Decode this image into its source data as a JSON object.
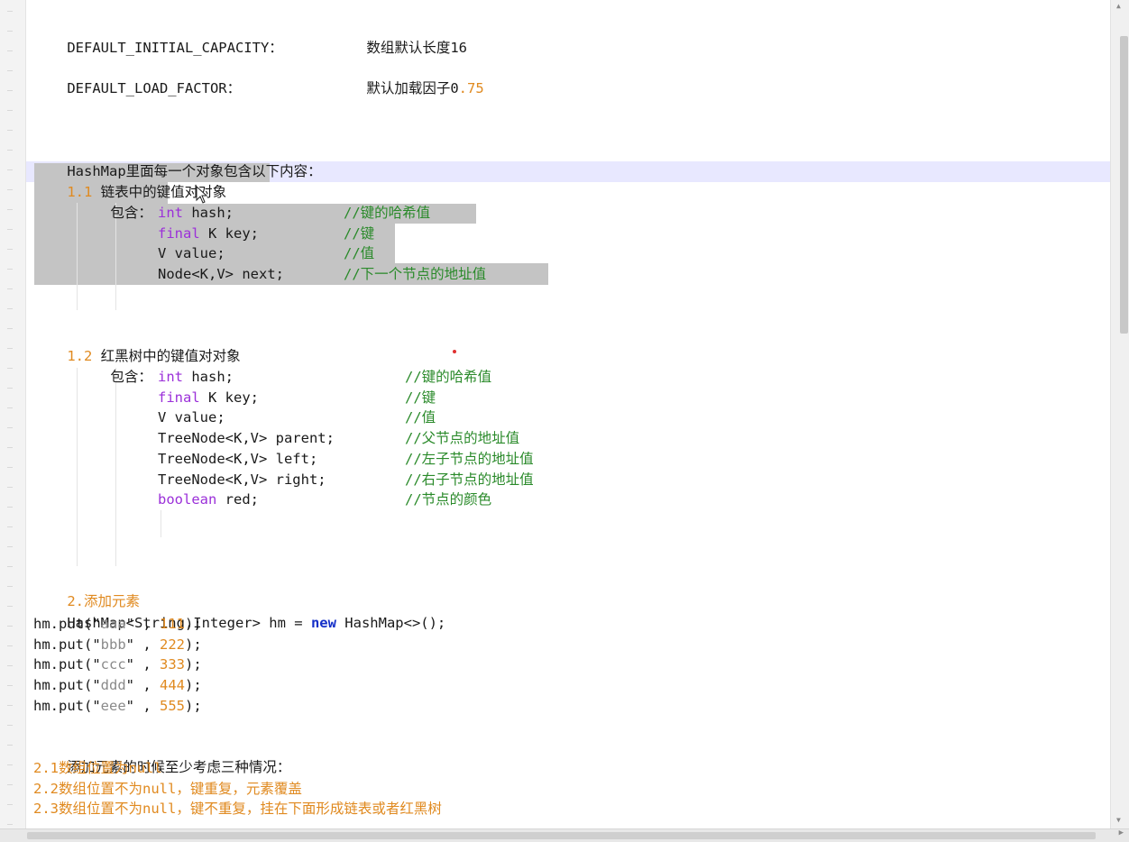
{
  "constants": {
    "capacity_name": "DEFAULT_INITIAL_CAPACITY：",
    "capacity_desc": "数组默认长度16",
    "load_factor_name": "DEFAULT_LOAD_FACTOR：",
    "load_factor_desc_text": "默认加载因子0",
    "load_factor_desc_num": ".75"
  },
  "hashmap_intro": "HashMap里面每一个对象包含以下内容：",
  "section_1_1": {
    "number": "1.1",
    "title": "链表中的键值对对象",
    "contains_label": "包含：",
    "fields": [
      {
        "kw": "int",
        "rest": " hash;",
        "comment": "//键的哈希值"
      },
      {
        "kw": "final",
        "rest": " K key;",
        "comment": "//键"
      },
      {
        "kw": "",
        "rest": "V value;",
        "comment": "//值"
      },
      {
        "kw": "",
        "rest": "Node<K,V> next;",
        "comment": "//下一个节点的地址值"
      }
    ]
  },
  "section_1_2": {
    "number": "1.2",
    "title": "红黑树中的键值对对象",
    "contains_label": "包含：",
    "fields": [
      {
        "kw": "int",
        "rest": " hash;",
        "comment": "//键的哈希值"
      },
      {
        "kw": "final",
        "rest": " K key;",
        "comment": "//键"
      },
      {
        "kw": "",
        "rest": "V value;",
        "comment": "//值"
      },
      {
        "kw": "",
        "rest": "TreeNode<K,V> parent;",
        "comment": "//父节点的地址值"
      },
      {
        "kw": "",
        "rest": "TreeNode<K,V> left;",
        "comment": "//左子节点的地址值"
      },
      {
        "kw": "",
        "rest": "TreeNode<K,V> right;",
        "comment": "//右子节点的地址值"
      },
      {
        "kw": "boolean",
        "rest": " red;",
        "comment": "//节点的颜色"
      }
    ]
  },
  "section_2": {
    "title": "2.添加元素",
    "decl_a": "HashMap<String,Integer> hm = ",
    "decl_new": "new",
    "decl_b": " HashMap<>();",
    "puts": [
      {
        "pre": "hm.put(\"",
        "key": "aaa",
        "mid": "\" , ",
        "val": "111",
        "post": ");"
      },
      {
        "pre": "hm.put(\"",
        "key": "bbb",
        "mid": "\" , ",
        "val": "222",
        "post": ");"
      },
      {
        "pre": "hm.put(\"",
        "key": "ccc",
        "mid": "\" , ",
        "val": "333",
        "post": ");"
      },
      {
        "pre": "hm.put(\"",
        "key": "ddd",
        "mid": "\" , ",
        "val": "444",
        "post": ");"
      },
      {
        "pre": "hm.put(\"",
        "key": "eee",
        "mid": "\" , ",
        "val": "555",
        "post": ");"
      }
    ]
  },
  "cases": {
    "intro": "添加元素的时候至少考虑三种情况：",
    "items": [
      "2.1数组位置为null",
      "2.2数组位置不为null，键重复，元素覆盖",
      "2.3数组位置不为null，键不重复，挂在下面形成链表或者红黑树"
    ]
  },
  "colors": {
    "keyword": "#9b30d9",
    "new_keyword": "#1530c8",
    "comment": "#2a8a2a",
    "number": "#e08a20",
    "string": "#8a8a8a",
    "selection": "#c4c4c4"
  }
}
